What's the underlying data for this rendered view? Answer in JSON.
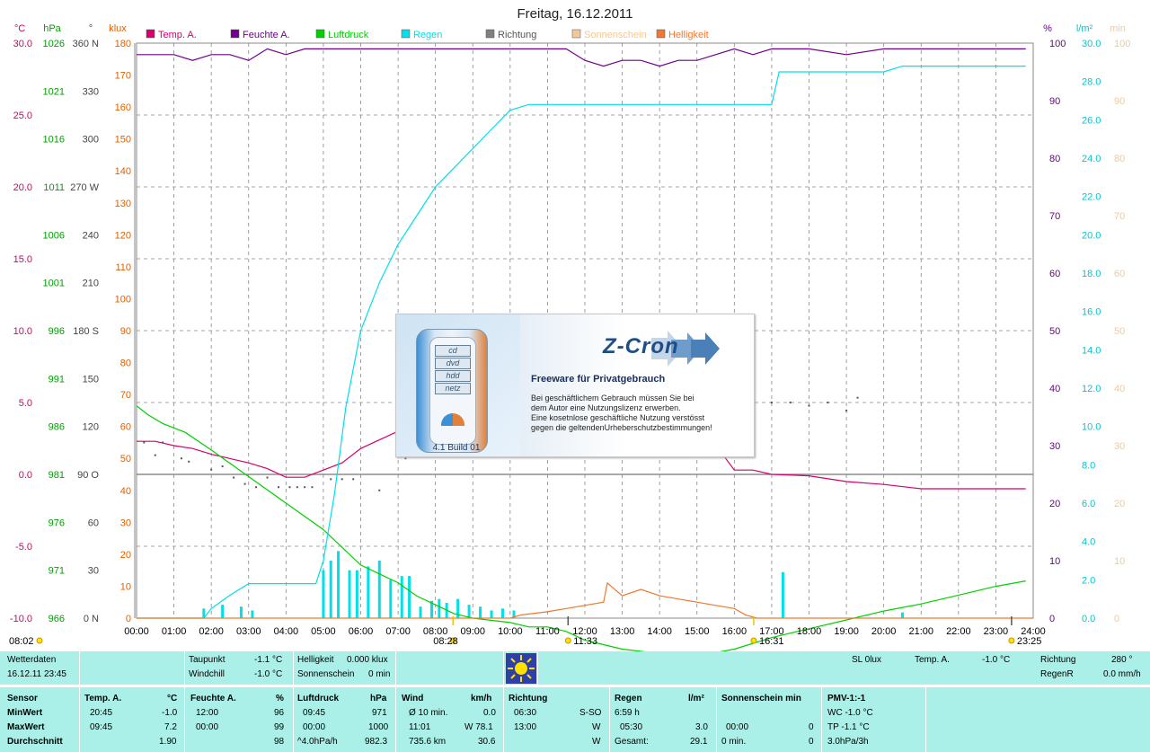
{
  "chart_data": {
    "type": "line",
    "title": "Freitag, 16.12.2011",
    "x_ticks": [
      "00:00",
      "01:00",
      "02:00",
      "03:00",
      "04:00",
      "05:00",
      "06:00",
      "07:00",
      "08:00",
      "09:00",
      "10:00",
      "11:00",
      "12:00",
      "13:00",
      "14:00",
      "15:00",
      "16:00",
      "17:00",
      "18:00",
      "19:00",
      "20:00",
      "21:00",
      "22:00",
      "23:00",
      "24:00"
    ],
    "legend": [
      {
        "name": "Temp. A.",
        "color": "#d4006e"
      },
      {
        "name": "Feuchte A.",
        "color": "#70008c"
      },
      {
        "name": "Luftdruck",
        "color": "#00d000"
      },
      {
        "name": "Regen",
        "color": "#00e0e8"
      },
      {
        "name": "Richtung",
        "color": "#808080"
      },
      {
        "name": "Sonnenschein",
        "color": "#f4c896"
      },
      {
        "name": "Helligkeit",
        "color": "#f07830"
      }
    ],
    "axes": {
      "temp": {
        "unit": "°C",
        "min": -10,
        "max": 30,
        "ticks": [
          "30.0",
          "25.0",
          "20.0",
          "15.0",
          "10.0",
          "5.0",
          "0.0",
          "-5.0",
          "-10.0"
        ],
        "color": "#d4006e"
      },
      "pressure": {
        "unit": "hPa",
        "min": 966,
        "max": 1031,
        "ticks": [
          "1026",
          "1021",
          "1016",
          "1011",
          "1006",
          "1001",
          "996",
          "991",
          "986",
          "981",
          "976",
          "971",
          "966"
        ],
        "color": "#00a000"
      },
      "direction": {
        "unit": "°",
        "min": 0,
        "max": 360,
        "ticks": [
          "360 N",
          "330",
          "300",
          "270 W",
          "240",
          "210",
          "180 S",
          "150",
          "120",
          "90 O",
          "60",
          "30",
          "0 N"
        ],
        "color": "#444444"
      },
      "lux": {
        "unit": "klux",
        "min": 0,
        "max": 180,
        "ticks": [
          "180",
          "170",
          "160",
          "150",
          "140",
          "130",
          "120",
          "110",
          "100",
          "90",
          "80",
          "70",
          "60",
          "50",
          "40",
          "30",
          "20",
          "10",
          "0"
        ],
        "color": "#e06000"
      },
      "humidity": {
        "unit": "%",
        "min": 0,
        "max": 100,
        "ticks": [
          "100",
          "90",
          "80",
          "70",
          "60",
          "50",
          "40",
          "30",
          "20",
          "10",
          "0"
        ],
        "color": "#70008c"
      },
      "rain": {
        "unit": "l/m²",
        "min": 0,
        "max": 30,
        "ticks": [
          "30.0",
          "28.0",
          "26.0",
          "24.0",
          "22.0",
          "20.0",
          "18.0",
          "16.0",
          "14.0",
          "12.0",
          "10.0",
          "8.0",
          "6.0",
          "4.0",
          "2.0",
          "0.0"
        ],
        "color": "#00c8d0"
      },
      "sun": {
        "unit": "min",
        "min": 0,
        "max": 100,
        "ticks": [
          "100",
          "90",
          "80",
          "70",
          "60",
          "50",
          "40",
          "30",
          "20",
          "10",
          "0"
        ],
        "color": "#f4c896"
      }
    },
    "series": [
      {
        "name": "Temp. A.",
        "axis": "temp",
        "color": "#d4006e",
        "points": [
          [
            0,
            2.3
          ],
          [
            0.5,
            2.3
          ],
          [
            1,
            2.0
          ],
          [
            1.5,
            1.8
          ],
          [
            2,
            1.4
          ],
          [
            2.5,
            1.1
          ],
          [
            3,
            0.8
          ],
          [
            3.5,
            0.4
          ],
          [
            4,
            -0.2
          ],
          [
            4.5,
            -0.2
          ],
          [
            5,
            0.3
          ],
          [
            5.5,
            0.8
          ],
          [
            6,
            1.8
          ],
          [
            6.5,
            2.4
          ],
          [
            7,
            3.0
          ],
          [
            7.5,
            3.3
          ],
          [
            8,
            4.0
          ],
          [
            8.5,
            4.8
          ],
          [
            9,
            5.0
          ],
          [
            9.5,
            5.6
          ],
          [
            10,
            6.2
          ],
          [
            10.5,
            6.8
          ],
          [
            11,
            7.2
          ],
          [
            11.5,
            7.0
          ],
          [
            12,
            6.9
          ],
          [
            13,
            6.7
          ],
          [
            14,
            6.1
          ],
          [
            15,
            3.8
          ],
          [
            16,
            0.3
          ],
          [
            16.5,
            0.3
          ],
          [
            17,
            0.0
          ],
          [
            18,
            -0.1
          ],
          [
            19,
            -0.5
          ],
          [
            20,
            -0.7
          ],
          [
            21,
            -1.0
          ],
          [
            22,
            -1.0
          ],
          [
            23,
            -1.0
          ],
          [
            23.8,
            -1.0
          ]
        ]
      },
      {
        "name": "Feuchte A.",
        "axis": "humidity",
        "color": "#70008c",
        "points": [
          [
            0,
            98
          ],
          [
            0.5,
            98
          ],
          [
            1,
            98
          ],
          [
            1.5,
            97
          ],
          [
            2,
            98
          ],
          [
            2.5,
            98
          ],
          [
            3,
            97
          ],
          [
            3.5,
            99
          ],
          [
            4,
            98
          ],
          [
            4.5,
            99
          ],
          [
            5,
            99
          ],
          [
            6,
            99
          ],
          [
            7,
            99
          ],
          [
            8,
            99
          ],
          [
            9,
            99
          ],
          [
            10,
            99
          ],
          [
            11,
            99
          ],
          [
            11.5,
            99
          ],
          [
            12,
            97
          ],
          [
            12.5,
            96
          ],
          [
            13,
            97
          ],
          [
            13.5,
            97
          ],
          [
            14,
            96
          ],
          [
            14.5,
            97
          ],
          [
            15,
            97
          ],
          [
            15.5,
            98
          ],
          [
            16,
            99
          ],
          [
            16.5,
            98
          ],
          [
            17,
            99
          ],
          [
            18,
            99
          ],
          [
            19,
            98
          ],
          [
            20,
            99
          ],
          [
            21,
            99
          ],
          [
            22,
            99
          ],
          [
            23,
            99
          ],
          [
            23.8,
            99
          ]
        ]
      },
      {
        "name": "Luftdruck",
        "axis": "pressure",
        "color": "#00d000",
        "points": [
          [
            0,
            990
          ],
          [
            0.3,
            989
          ],
          [
            0.7,
            988
          ],
          [
            1.3,
            987
          ],
          [
            2,
            985
          ],
          [
            3,
            982
          ],
          [
            4,
            979
          ],
          [
            5,
            976
          ],
          [
            5.5,
            974
          ],
          [
            6,
            972
          ],
          [
            6.5,
            971
          ],
          [
            7,
            970
          ],
          [
            7.5,
            968.5
          ],
          [
            8,
            967.5
          ],
          [
            8.5,
            966.5
          ],
          [
            9,
            966
          ],
          [
            10,
            965.5
          ],
          [
            10.5,
            965
          ],
          [
            11,
            965
          ],
          [
            11.5,
            964.5
          ],
          [
            12,
            963.5
          ],
          [
            12.5,
            963
          ],
          [
            13,
            962.5
          ],
          [
            14,
            962
          ],
          [
            15,
            961.7
          ],
          [
            16,
            962.5
          ],
          [
            17,
            963.8
          ],
          [
            18,
            964.8
          ],
          [
            19,
            965.8
          ],
          [
            20,
            966.8
          ],
          [
            21,
            967.6
          ],
          [
            22,
            968.6
          ],
          [
            23,
            969.6
          ],
          [
            23.8,
            970.2
          ]
        ]
      },
      {
        "name": "Regen",
        "axis": "rain",
        "color": "#00e0e8",
        "points": [
          [
            0,
            0
          ],
          [
            1.8,
            0
          ],
          [
            2,
            0.5
          ],
          [
            2.5,
            1.2
          ],
          [
            3,
            1.8
          ],
          [
            4,
            1.8
          ],
          [
            4.8,
            1.8
          ],
          [
            5,
            3.0
          ],
          [
            5.3,
            6.5
          ],
          [
            5.6,
            11
          ],
          [
            6,
            15
          ],
          [
            6.5,
            17.5
          ],
          [
            7,
            19.5
          ],
          [
            7.5,
            21
          ],
          [
            8,
            22.5
          ],
          [
            8.5,
            23.5
          ],
          [
            9,
            24.5
          ],
          [
            9.5,
            25.5
          ],
          [
            10,
            26.5
          ],
          [
            10.5,
            26.8
          ],
          [
            11,
            26.8
          ],
          [
            12,
            26.8
          ],
          [
            13,
            26.8
          ],
          [
            14,
            26.8
          ],
          [
            15,
            26.8
          ],
          [
            16,
            26.8
          ],
          [
            17,
            26.8
          ],
          [
            17.2,
            28.5
          ],
          [
            18,
            28.5
          ],
          [
            19,
            28.5
          ],
          [
            20,
            28.5
          ],
          [
            20.5,
            28.8
          ],
          [
            21,
            28.8
          ],
          [
            22,
            28.8
          ],
          [
            23,
            28.8
          ],
          [
            23.8,
            28.8
          ]
        ]
      },
      {
        "name": "Helligkeit",
        "axis": "lux",
        "color": "#f07830",
        "points": [
          [
            0,
            0
          ],
          [
            10,
            0
          ],
          [
            10.3,
            1
          ],
          [
            11,
            2
          ],
          [
            11.5,
            3
          ],
          [
            12,
            4
          ],
          [
            12.5,
            5
          ],
          [
            12.6,
            11
          ],
          [
            13,
            7
          ],
          [
            13.5,
            9
          ],
          [
            14,
            7
          ],
          [
            14.5,
            6
          ],
          [
            15,
            5
          ],
          [
            15.5,
            4
          ],
          [
            16,
            3
          ],
          [
            16.3,
            1
          ],
          [
            16.6,
            0
          ],
          [
            24,
            0
          ]
        ]
      }
    ],
    "direction_points": [
      [
        0.2,
        110
      ],
      [
        0.5,
        102
      ],
      [
        0.7,
        110
      ],
      [
        1.2,
        100
      ],
      [
        1.4,
        98
      ],
      [
        2,
        93
      ],
      [
        2.3,
        95
      ],
      [
        2.6,
        88
      ],
      [
        2.9,
        84
      ],
      [
        3.2,
        82
      ],
      [
        3.5,
        88
      ],
      [
        3.8,
        82
      ],
      [
        4.1,
        82
      ],
      [
        4.3,
        82
      ],
      [
        4.5,
        82
      ],
      [
        4.7,
        82
      ],
      [
        5.2,
        87
      ],
      [
        5.5,
        87
      ],
      [
        5.8,
        87
      ],
      [
        6.5,
        80
      ],
      [
        7.2,
        100
      ],
      [
        7.5,
        103
      ],
      [
        7.8,
        107
      ],
      [
        8.2,
        108
      ],
      [
        8.5,
        118
      ],
      [
        8.7,
        112
      ],
      [
        9,
        112
      ],
      [
        9.3,
        116
      ],
      [
        9.5,
        113
      ],
      [
        9.8,
        115
      ],
      [
        10,
        127
      ],
      [
        10.5,
        123
      ],
      [
        10.7,
        127
      ],
      [
        11,
        130
      ],
      [
        11.4,
        125
      ],
      [
        11.7,
        130
      ],
      [
        12,
        130
      ],
      [
        12.3,
        125
      ],
      [
        12.8,
        130
      ],
      [
        13.2,
        130
      ],
      [
        13.5,
        132
      ],
      [
        14,
        133
      ],
      [
        14.5,
        135
      ],
      [
        15,
        133
      ],
      [
        15.3,
        130
      ],
      [
        15.7,
        135
      ],
      [
        16,
        133
      ],
      [
        16.5,
        135
      ],
      [
        17,
        135
      ],
      [
        17.5,
        135
      ],
      [
        18,
        133
      ],
      [
        18.5,
        135
      ],
      [
        19,
        130
      ],
      [
        19.3,
        138
      ]
    ],
    "rain_bars": [
      [
        1.8,
        0.5
      ],
      [
        2.3,
        0.7
      ],
      [
        2.8,
        0.6
      ],
      [
        3.1,
        0.4
      ],
      [
        5,
        2.5
      ],
      [
        5.2,
        3
      ],
      [
        5.4,
        3.5
      ],
      [
        5.7,
        2.5
      ],
      [
        5.9,
        2.5
      ],
      [
        6.2,
        2.7
      ],
      [
        6.5,
        3
      ],
      [
        6.8,
        2
      ],
      [
        7.1,
        2.2
      ],
      [
        7.3,
        2.2
      ],
      [
        7.6,
        0.6
      ],
      [
        7.9,
        0.9
      ],
      [
        8.1,
        1
      ],
      [
        8.3,
        0.8
      ],
      [
        8.6,
        1
      ],
      [
        8.9,
        0.7
      ],
      [
        9.2,
        0.6
      ],
      [
        9.5,
        0.4
      ],
      [
        9.8,
        0.5
      ],
      [
        10.1,
        0.4
      ],
      [
        17.3,
        2.4
      ],
      [
        20.5,
        0.3
      ]
    ],
    "sun_markers": [
      {
        "label": "08:28",
        "x": 8.47
      },
      {
        "label": "11:33",
        "x": 11.55
      },
      {
        "label": "16:31",
        "x": 16.52
      },
      {
        "label": "23:25",
        "x": 23.42
      }
    ],
    "bottom_left_time": "08:02"
  },
  "info_bar": {
    "wetterdaten": "Wetterdaten",
    "datetime": "16.12.11 23:45",
    "taupunkt_label": "Taupunkt",
    "taupunkt_value": "-1.1 °C",
    "windchill_label": "Windchill",
    "windchill_value": "-1.0 °C",
    "helligkeit_label": "Helligkeit",
    "helligkeit_value": "0.000 klux",
    "sonnenschein_label": "Sonnenschein",
    "sonnenschein_value": "0 min",
    "sl": "SL 0lux",
    "temp_label": "Temp. A.",
    "temp_value": "-1.0 °C",
    "richtung_label": "Richtung",
    "richtung_value": "280 °",
    "regenr_label": "RegenR",
    "regenr_value": "0.0 mm/h"
  },
  "table": {
    "sensor": {
      "head": "Sensor",
      "min": "MinWert",
      "max": "MaxWert",
      "avg": "Durchschnitt"
    },
    "temp": {
      "head": "Temp. A.",
      "unit": "°C",
      "min_t": "20:45",
      "min_v": "-1.0",
      "max_t": "09:45",
      "max_v": "7.2",
      "avg_v": "1.90"
    },
    "feuchte": {
      "head": "Feuchte A.",
      "unit": "%",
      "min_t": "12:00",
      "min_v": "96",
      "max_t": "00:00",
      "max_v": "99",
      "avg_v": "98"
    },
    "luftdruck": {
      "head": "Luftdruck",
      "unit": "hPa",
      "min_t": "09:45",
      "min_v": "971",
      "max_t": "00:00",
      "max_v": "1000",
      "avg_t": "^4.0hPa/h",
      "avg_v": "982.3"
    },
    "wind": {
      "head": "Wind",
      "unit": "km/h",
      "r1_l": "Ø 10 min.",
      "r1_v": "0.0",
      "r2_l": "11:01",
      "r2_v": "W 78.1",
      "r3_l": "735.6 km",
      "r3_v": "30.6"
    },
    "richtung": {
      "head": "Richtung",
      "r1_l": "06:30",
      "r1_v": "S-SO",
      "r2_l": "13:00",
      "r2_v": "W",
      "r3_v": "W"
    },
    "regen": {
      "head": "Regen",
      "unit": "l/m²",
      "r1_l": "6:59 h",
      "r2_l": "05:30",
      "r2_v": "3.0",
      "r3_l": "Gesamt:",
      "r3_v": "29.1"
    },
    "sonne": {
      "head": "Sonnenschein min",
      "r2_l": "00:00",
      "r2_v": "0",
      "r3_l": "0 min.",
      "r3_v": "0"
    },
    "pmv": {
      "head": "PMV-1:-1",
      "r1": "WC -1.0 °C",
      "r2": "TP -1.1 °C",
      "r3": "3.0hPa/3h"
    }
  },
  "splash": {
    "chips": [
      "cd",
      "dvd",
      "hdd",
      "netz"
    ],
    "title": "Z-Cron",
    "subtitle": "Freeware für Privatgebrauch",
    "text1": "Bei geschäftlichem Gebrauch müssen Sie bei",
    "text2": "dem Autor eine Nutzungslizenz erwerben.",
    "text3": "Eine kosetnlose geschäftliche Nutzung verstösst",
    "text4": "gegen die geltendenUrheberschutzbestimmungen!",
    "version": "4.1 Build 01"
  }
}
